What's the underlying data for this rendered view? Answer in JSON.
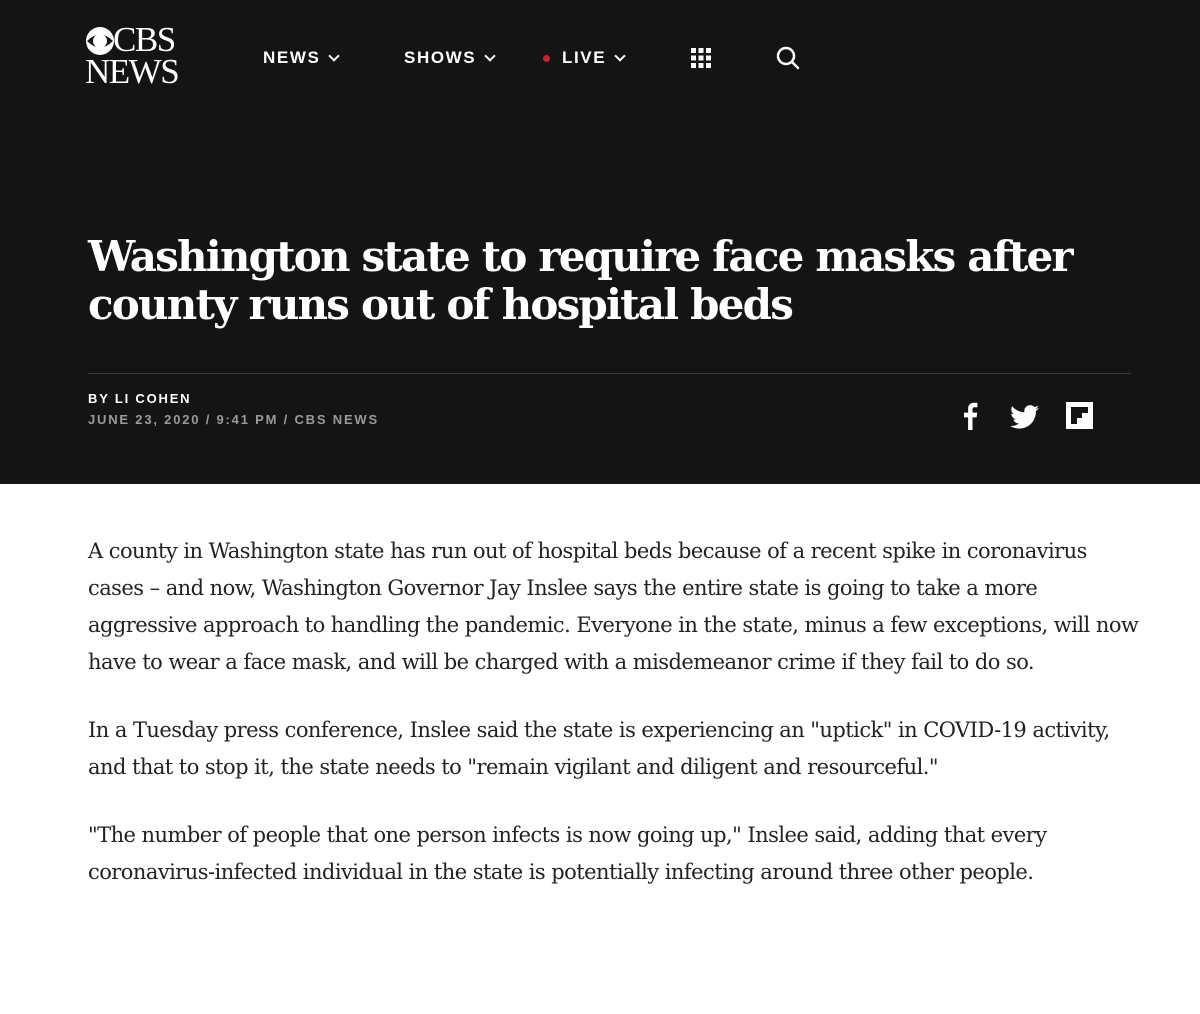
{
  "brand": {
    "line1": "CBS",
    "line2": "NEWS"
  },
  "nav": {
    "news": "NEWS",
    "shows": "SHOWS",
    "live": "LIVE",
    "apps_icon": "grid-icon",
    "search_icon": "search-icon",
    "live_dot_color": "#d31f25"
  },
  "article": {
    "headline": "Washington state to require face masks after county runs out of hospital beds",
    "byline": "BY LI COHEN",
    "meta": "JUNE 23, 2020 / 9:41 PM / CBS NEWS",
    "share_icons": [
      "facebook-icon",
      "twitter-icon",
      "flipboard-icon"
    ],
    "paragraphs": [
      "A county in Washington state has run out of hospital beds because of a recent spike in coronavirus cases – and now, Washington Governor Jay Inslee says the entire state is going to take a more aggressive approach to handling the pandemic. Everyone in the state, minus a few exceptions, will now have to wear a face mask, and will be charged with a misdemeanor crime if they fail to do so.",
      "In a Tuesday press conference, Inslee said the state is experiencing an \"uptick\" in COVID-19 activity, and that to stop it, the state needs to \"remain vigilant and diligent and resourceful.\"",
      "\"The number of people that one person infects is now going up,\" Inslee said, adding that every coronavirus-infected individual in the state is potentially infecting around three other people."
    ]
  },
  "colors": {
    "hero_bg": "#141414",
    "body_text": "#222222",
    "meta_text": "#9a9a9a"
  }
}
